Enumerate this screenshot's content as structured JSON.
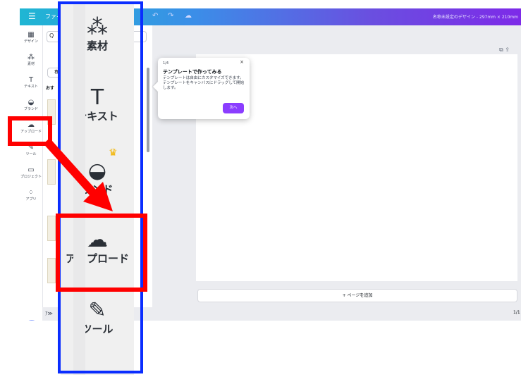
{
  "topbar": {
    "menu_icon": "☰",
    "file_label": "ファイ",
    "undo_icon": "↶",
    "redo_icon": "↷",
    "cloud_icon": "☁",
    "doc_title": "名称未設定のデザイン - 297mm × 210mm"
  },
  "rail": {
    "items": [
      {
        "icon": "design-icon",
        "glyph": "▦",
        "label": "デザイン"
      },
      {
        "icon": "elements-icon",
        "glyph": "⁂",
        "label": "素材"
      },
      {
        "icon": "text-icon",
        "glyph": "T",
        "label": "テキスト"
      },
      {
        "icon": "brand-icon",
        "glyph": "◒",
        "label": "ブランド"
      },
      {
        "icon": "upload-icon",
        "glyph": "☁",
        "label": "アップロード"
      },
      {
        "icon": "tools-icon",
        "glyph": "✎",
        "label": "ツール"
      },
      {
        "icon": "projects-icon",
        "glyph": "▭",
        "label": "プロジェクト"
      },
      {
        "icon": "apps-icon",
        "glyph": "⁘",
        "label": "アプリ"
      }
    ]
  },
  "panel": {
    "search_glyph": "Q",
    "chip": "春",
    "section": "おす"
  },
  "bottom_tab": "ｱ≫",
  "zoom": {
    "items": [
      {
        "glyph": "⁂",
        "label": "素材"
      },
      {
        "glyph": "T",
        "label": "テキスト"
      },
      {
        "glyph": "◒",
        "label": "ランド"
      },
      {
        "glyph": "☁",
        "label": "アップロード"
      },
      {
        "glyph": "✎",
        "label": "ツール"
      }
    ],
    "crown": "♛"
  },
  "popup": {
    "step": "1/4",
    "close": "×",
    "title": "テンプレートで作ってみる",
    "body": "テンプレートは自由にカスタマイズできます。テンプレートをキャンバスにドラッグして開始します。",
    "next": "次へ"
  },
  "canvas": {
    "add_page": "+ ページを追加",
    "page_count": "1/1",
    "tools": "⧉  ⇪"
  },
  "colors": {
    "highlight_red": "#ff0000",
    "highlight_blue": "#0a2dff",
    "accent": "#8b3dff"
  }
}
